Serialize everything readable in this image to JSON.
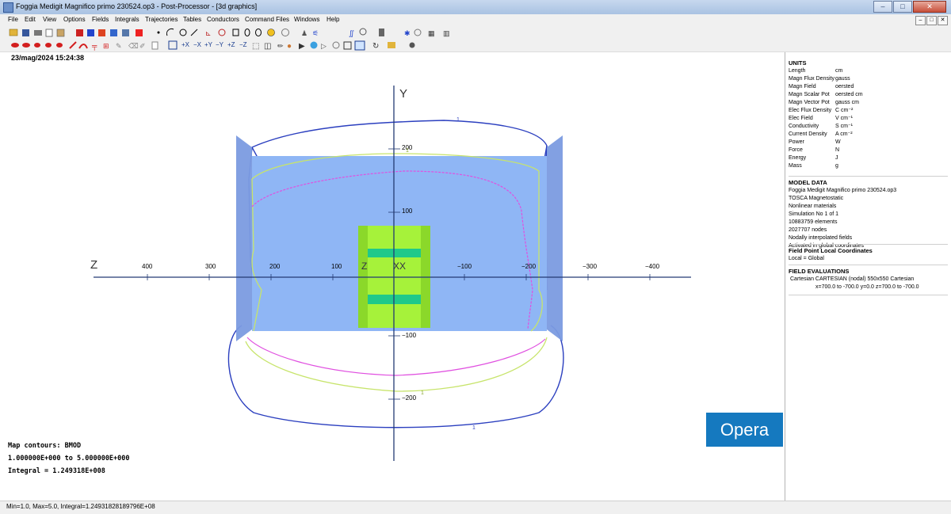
{
  "window": {
    "title": "Foggia Medigit Magnifico primo 230524.op3 - Post-Processor - [3d graphics]",
    "buttons": [
      "–",
      "□",
      "✕"
    ]
  },
  "menu": {
    "items": [
      "File",
      "Edit",
      "View",
      "Options",
      "Fields",
      "Integrals",
      "Trajectories",
      "Tables",
      "Conductors",
      "Command Files",
      "Windows",
      "Help"
    ]
  },
  "toolbar": {
    "view_buttons": [
      "+X",
      "−X",
      "+Y",
      "−Y",
      "+Z",
      "−Z"
    ]
  },
  "graphics": {
    "timestamp": "23/mag/2024 15:24:38",
    "axis_y_label": "Y",
    "axis_z_label": "Z",
    "axis_z_ticks": [
      "400",
      "300",
      "200",
      "100",
      "−100",
      "−200",
      "−300",
      "−400"
    ],
    "axis_y_ticks": [
      "200",
      "100",
      "−100",
      "−200"
    ],
    "origin_labels": [
      "Z",
      "XX"
    ],
    "contour_labels": [
      "1",
      "1",
      "1",
      "1"
    ],
    "map_title": "Map contours: BMOD",
    "map_range": "1.000000E+000 to 5.000000E+000",
    "integral": "Integral = 1.249318E+008",
    "logo": "Opera"
  },
  "colors": {
    "plane": "#8fb6f5",
    "side_plates": "#7b9be0",
    "magnet_green": "#a6f23a",
    "magnet_band": "#1fc98a",
    "contour_blue": "#2b3fbf",
    "contour_yellow": "#c7e46b",
    "contour_magenta": "#e050e0",
    "logo_bg": "#1579bf"
  },
  "units": {
    "heading": "UNITS",
    "rows": [
      {
        "k": "Length",
        "v": "cm"
      },
      {
        "k": "Magn Flux Density",
        "v": "gauss"
      },
      {
        "k": "Magn Field",
        "v": "oersted"
      },
      {
        "k": "Magn Scalar Pot",
        "v": "oersted cm"
      },
      {
        "k": "Magn Vector Pot",
        "v": "gauss cm"
      },
      {
        "k": "Elec Flux Density",
        "v": "C cm⁻²"
      },
      {
        "k": "Elec Field",
        "v": "V cm⁻¹"
      },
      {
        "k": "Conductivity",
        "v": "S cm⁻¹"
      },
      {
        "k": "Current Density",
        "v": "A cm⁻²"
      },
      {
        "k": "Power",
        "v": "W"
      },
      {
        "k": "Force",
        "v": "N"
      },
      {
        "k": "Energy",
        "v": "J"
      },
      {
        "k": "Mass",
        "v": "g"
      }
    ]
  },
  "model_data": {
    "heading": "MODEL DATA",
    "rows": [
      "Foggia Medigit Magnifico primo 230524.op3",
      "TOSCA Magnetostatic",
      "Nonlinear materials",
      "Simulation No 1 of 1",
      "10883759 elements",
      "2027707 nodes",
      "Nodally interpolated fields",
      "Activated in global coordinates"
    ]
  },
  "field_point": {
    "heading": "Field Point Local Coordinates",
    "row": "Local = Global"
  },
  "field_eval": {
    "heading": "FIELD EVALUATIONS",
    "row1": "Cartesian  CARTESIAN (nodal)  550x550  Cartesian",
    "row2": "x=700.0 to -700.0  y=0.0   z=700.0 to -700.0"
  },
  "status": {
    "text": "Min=1.0, Max=5.0, Integral=1.24931828189796E+08"
  }
}
